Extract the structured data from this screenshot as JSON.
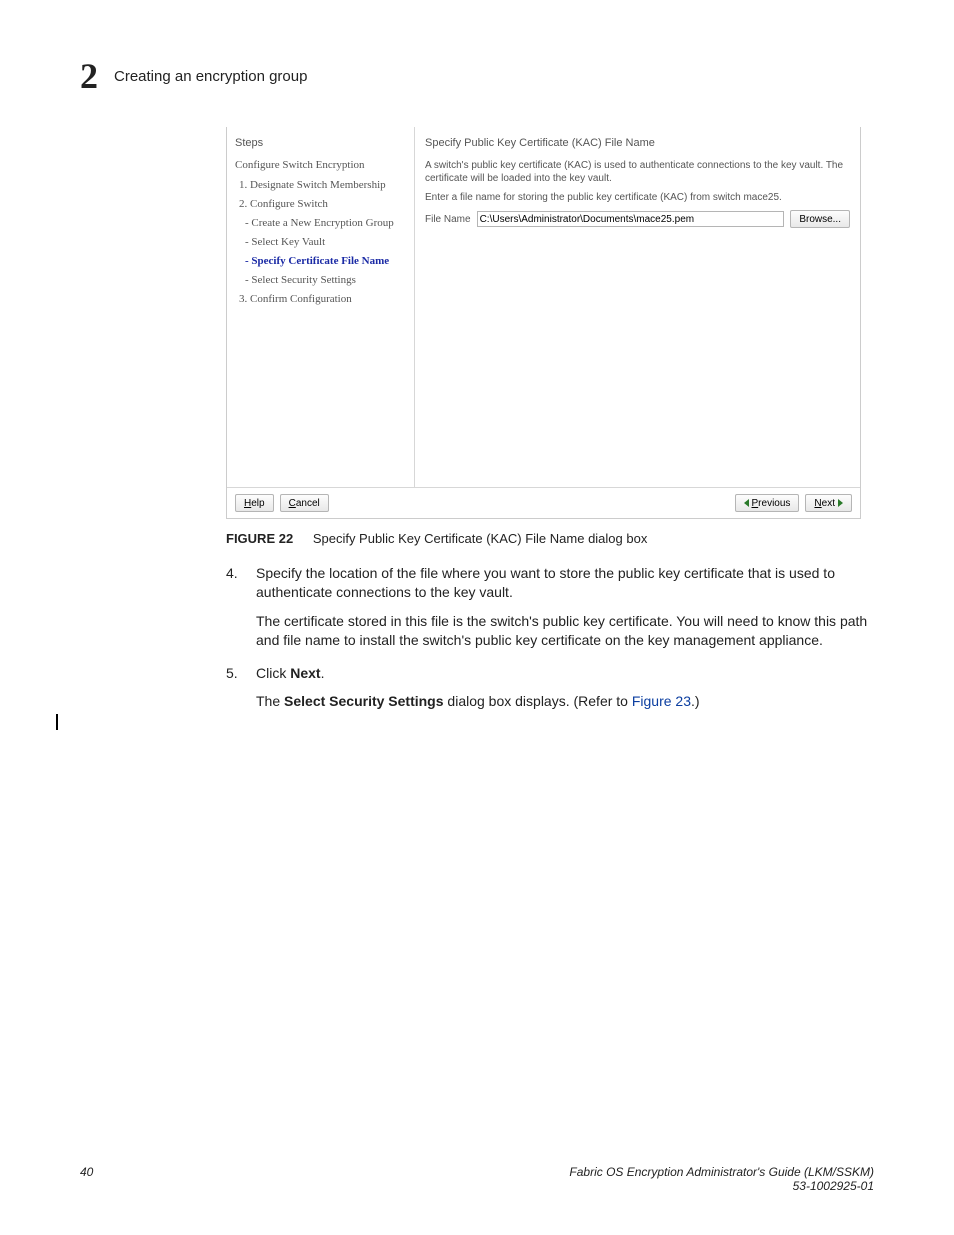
{
  "header": {
    "chapter_number": "2",
    "chapter_title": "Creating an encryption group"
  },
  "dialog": {
    "steps_header": "Steps",
    "right_header": "Specify Public Key Certificate (KAC) File Name",
    "steps": {
      "s0": "Configure Switch Encryption",
      "s1": "1. Designate Switch Membership",
      "s2": "2. Configure Switch",
      "s2a": "- Create a New Encryption Group",
      "s2b": "- Select Key Vault",
      "s2c": "- Specify Certificate File Name",
      "s2d": "- Select Security Settings",
      "s3": "3. Confirm Configuration"
    },
    "para1": "A switch's public key certificate (KAC) is used to authenticate connections to the key vault. The certificate will be loaded into the key vault.",
    "para2": "Enter a file name for storing the public key certificate (KAC) from switch mace25.",
    "file_label": "File Name",
    "file_value": "C:\\Users\\Administrator\\Documents\\mace25.pem",
    "browse": "Browse...",
    "help": "elp",
    "cancel": "ancel",
    "previous": "revious",
    "next": "ext"
  },
  "caption": {
    "label": "FIGURE 22",
    "text": "Specify Public Key Certificate (KAC) File Name dialog box"
  },
  "body": {
    "step4_num": "4.",
    "step4_text": "Specify the location of the file where you want to store the public key certificate that is used to authenticate connections to the key vault.",
    "step4_para": "The certificate stored in this file is the switch's public key certificate. You will need to know this path and file name to install the switch's public key certificate on the key management appliance.",
    "step5_num": "5.",
    "step5_click": "Click ",
    "step5_next": "Next",
    "step5_period": ".",
    "step5_para_a": "The ",
    "step5_para_b": "Select Security Settings",
    "step5_para_c": " dialog box displays. (Refer to ",
    "step5_para_link": "Figure 23",
    "step5_para_d": ".)"
  },
  "footer": {
    "page": "40",
    "title": "Fabric OS Encryption Administrator's Guide  (LKM/SSKM)",
    "docnum": "53-1002925-01"
  }
}
